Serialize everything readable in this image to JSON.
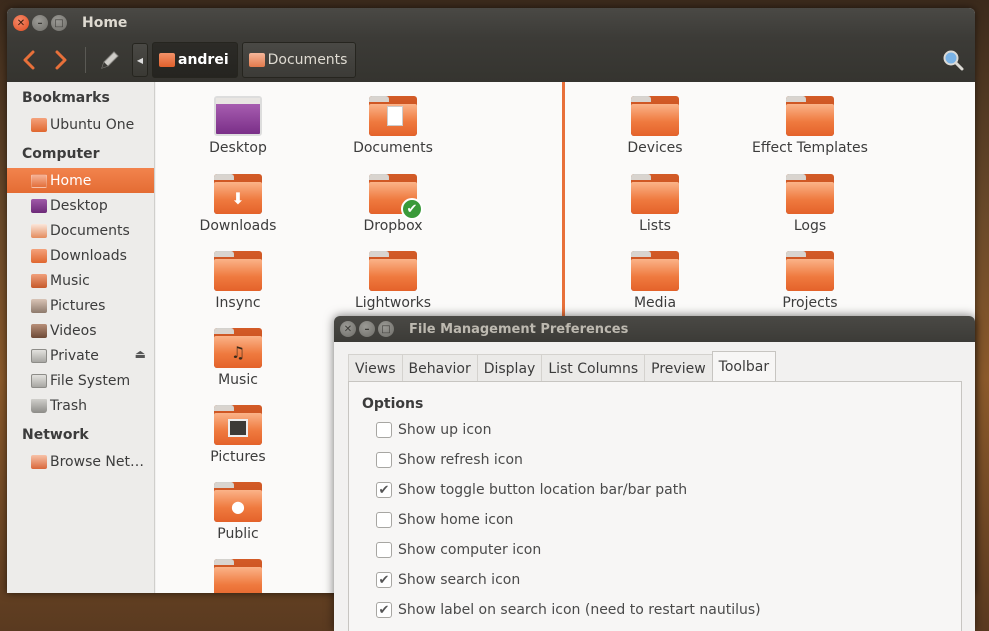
{
  "main_window": {
    "title": "Home",
    "breadcrumb": [
      {
        "label": "andrei",
        "active": true
      },
      {
        "label": "Documents",
        "active": false
      }
    ]
  },
  "sidebar": {
    "sections": {
      "bookmarks": "Bookmarks",
      "computer": "Computer",
      "network": "Network"
    },
    "bookmarks": [
      {
        "label": "Ubuntu One",
        "icon": "folder-icon"
      }
    ],
    "computer": [
      {
        "label": "Home",
        "icon": "home-folder-icon",
        "selected": true
      },
      {
        "label": "Desktop",
        "icon": "desktop-folder-icon"
      },
      {
        "label": "Documents",
        "icon": "documents-folder-icon"
      },
      {
        "label": "Downloads",
        "icon": "downloads-folder-icon"
      },
      {
        "label": "Music",
        "icon": "music-folder-icon"
      },
      {
        "label": "Pictures",
        "icon": "pictures-folder-icon"
      },
      {
        "label": "Videos",
        "icon": "videos-folder-icon"
      },
      {
        "label": "Private",
        "icon": "drive-icon",
        "eject": true
      },
      {
        "label": "File System",
        "icon": "drive-icon"
      },
      {
        "label": "Trash",
        "icon": "trash-icon"
      }
    ],
    "network": [
      {
        "label": "Browse Net…",
        "icon": "network-folder-icon"
      }
    ]
  },
  "left_pane": {
    "items": [
      {
        "label": "Desktop",
        "icon": "desktop-icon"
      },
      {
        "label": "Documents",
        "icon": "documents-folder-icon"
      },
      {
        "label": "Downloads",
        "icon": "downloads-folder-icon"
      },
      {
        "label": "Dropbox",
        "icon": "dropbox-folder-icon"
      },
      {
        "label": "Insync",
        "icon": "folder-icon"
      },
      {
        "label": "Lightworks",
        "icon": "folder-icon"
      },
      {
        "label": "Music",
        "icon": "music-folder-icon"
      },
      {
        "label": "Pictures",
        "icon": "pictures-folder-icon"
      },
      {
        "label": "Public",
        "icon": "public-folder-icon"
      }
    ]
  },
  "right_pane": {
    "items": [
      {
        "label": "Devices",
        "icon": "folder-icon"
      },
      {
        "label": "Effect Templates",
        "icon": "folder-icon"
      },
      {
        "label": "Lists",
        "icon": "folder-icon"
      },
      {
        "label": "Logs",
        "icon": "folder-icon"
      },
      {
        "label": "Media",
        "icon": "folder-icon"
      },
      {
        "label": "Projects",
        "icon": "folder-icon"
      }
    ]
  },
  "dialog": {
    "title": "File Management Preferences",
    "tabs": [
      {
        "label": "Views",
        "active": false
      },
      {
        "label": "Behavior",
        "active": false
      },
      {
        "label": "Display",
        "active": false
      },
      {
        "label": "List Columns",
        "active": false
      },
      {
        "label": "Preview",
        "active": false
      },
      {
        "label": "Toolbar",
        "active": true
      }
    ],
    "section_title": "Options",
    "options": [
      {
        "label": "Show up icon",
        "checked": false
      },
      {
        "label": "Show refresh icon",
        "checked": false
      },
      {
        "label": "Show toggle button location bar/bar path",
        "checked": true
      },
      {
        "label": "Show home icon",
        "checked": false
      },
      {
        "label": "Show computer icon",
        "checked": false
      },
      {
        "label": "Show search icon",
        "checked": true
      },
      {
        "label": "Show label on search icon (need to restart nautilus)",
        "checked": true
      }
    ]
  },
  "colors": {
    "accent": "#e8703a",
    "titlebar": "#3c3b37",
    "selection": "#e46c33"
  }
}
